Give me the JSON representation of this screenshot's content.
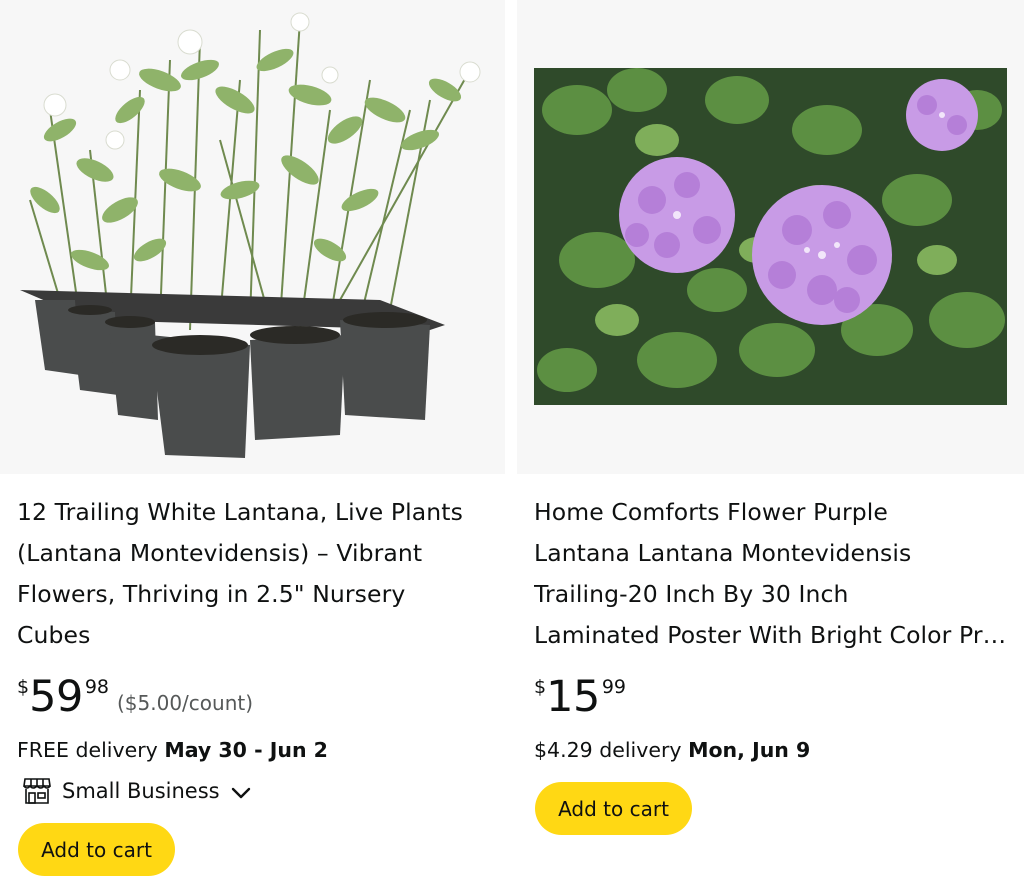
{
  "products": [
    {
      "title_lines": [
        "12 Trailing White Lantana, Live Plants",
        "(Lantana Montevidensis) – Vibrant",
        "Flowers, Thriving in 2.5\" Nursery",
        "Cubes"
      ],
      "price": {
        "symbol": "$",
        "whole": "59",
        "fraction": "98",
        "unit_price": "($5.00/count)"
      },
      "delivery": {
        "prefix": "FREE delivery",
        "date": "May 30 - Jun 2"
      },
      "badge": {
        "label": "Small Business",
        "icon": "store-icon"
      },
      "add_to_cart": "Add to cart"
    },
    {
      "title_lines": [
        "Home Comforts Flower Purple",
        "Lantana Lantana Montevidensis",
        "Trailing-20 Inch By 30 Inch",
        "Laminated Poster With Bright Color Print"
      ],
      "price": {
        "symbol": "$",
        "whole": "15",
        "fraction": "99"
      },
      "delivery": {
        "prefix": "$4.29 delivery",
        "date": "Mon, Jun 9"
      },
      "add_to_cart": "Add to cart"
    }
  ],
  "colors": {
    "button": "#ffd814",
    "text": "#0f1111",
    "muted": "#565959",
    "image_bg": "#f7f7f7"
  }
}
